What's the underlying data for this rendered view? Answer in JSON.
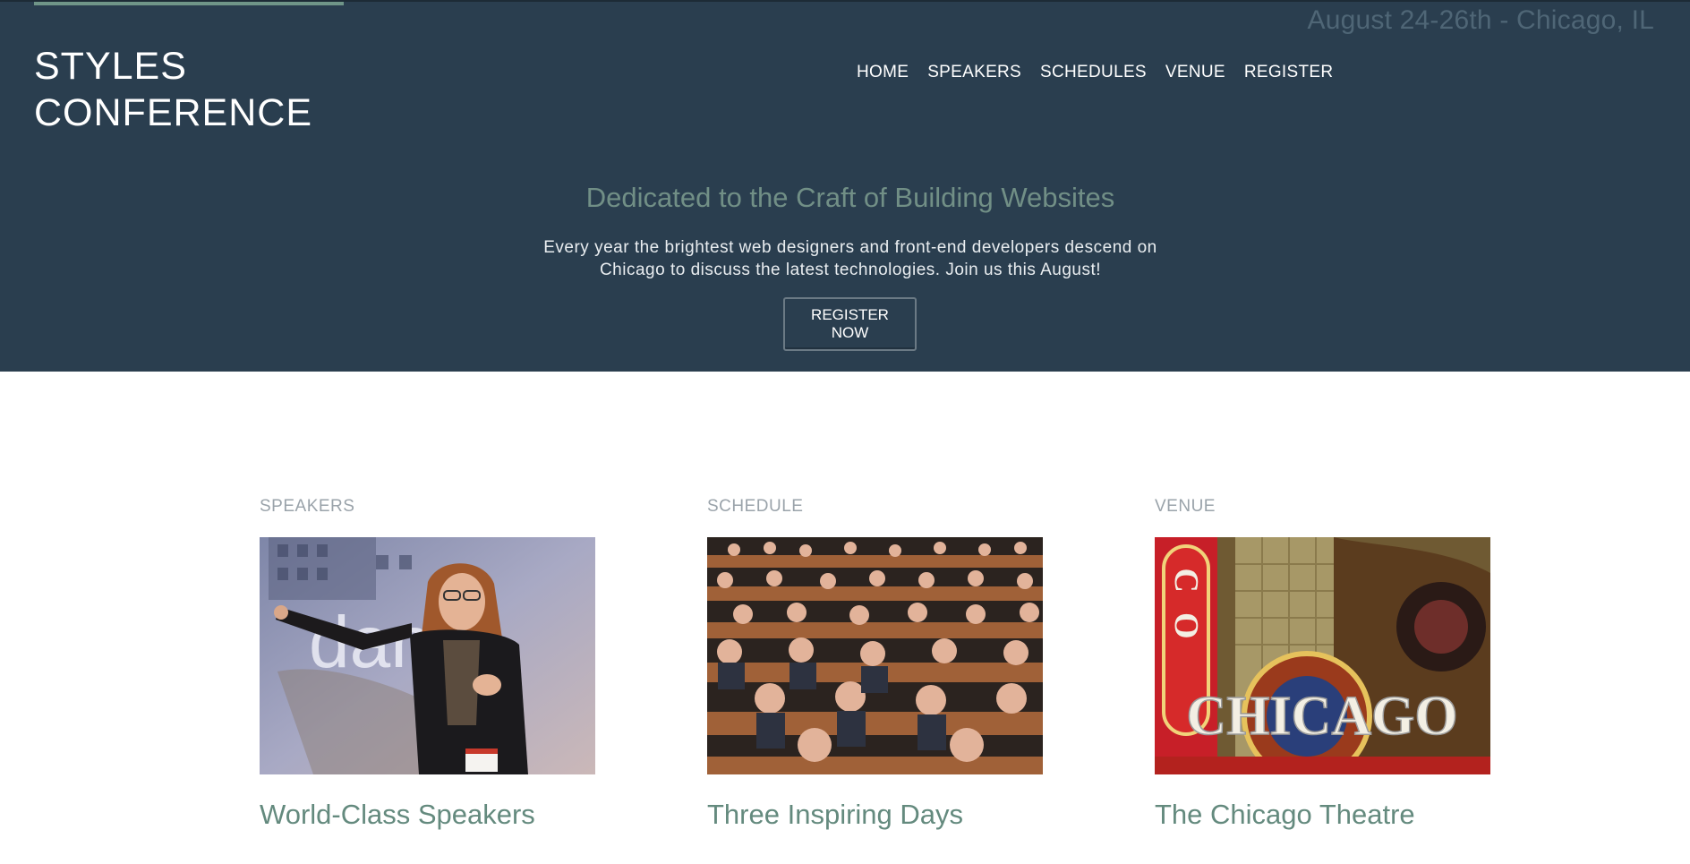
{
  "header": {
    "event_date": "August 24-26th - Chicago, IL",
    "logo_line1": "STYLES",
    "logo_line2": "CONFERENCE"
  },
  "nav": {
    "items": [
      {
        "label": "HOME"
      },
      {
        "label": "SPEAKERS"
      },
      {
        "label": "SCHEDULES"
      },
      {
        "label": "VENUE"
      },
      {
        "label": "REGISTER"
      }
    ]
  },
  "hero": {
    "title": "Dedicated to the Craft of Building Websites",
    "text": "Every year the brightest web designers and front-end developers descend on Chicago to discuss the latest technologies. Join us this August!",
    "cta_label": "REGISTER NOW"
  },
  "cards": [
    {
      "eyebrow": "SPEAKERS",
      "title": "World-Class Speakers"
    },
    {
      "eyebrow": "SCHEDULE",
      "title": "Three Inspiring Days"
    },
    {
      "eyebrow": "VENUE",
      "title": "The Chicago Theatre"
    }
  ],
  "image_text": {
    "speaker_slide": "danc",
    "theatre_sign_vertical": "CO",
    "theatre_sign": "CHICAGO"
  },
  "colors": {
    "hero_bg": "#2a3e4f",
    "accent": "#6f9588",
    "card_title": "#648a7e"
  }
}
